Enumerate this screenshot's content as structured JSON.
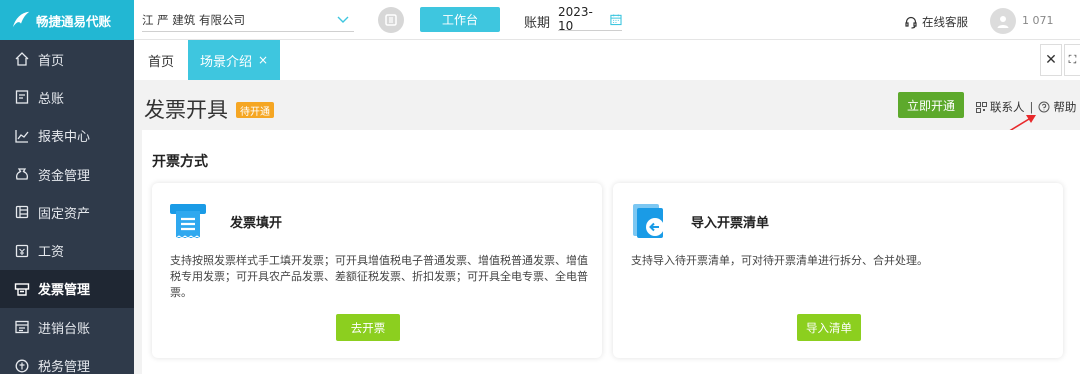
{
  "brand": {
    "name": "畅捷通易代账"
  },
  "sidebar": {
    "items": [
      {
        "label": "首页",
        "icon": "home-icon"
      },
      {
        "label": "总账",
        "icon": "ledger-icon"
      },
      {
        "label": "报表中心",
        "icon": "chart-icon"
      },
      {
        "label": "资金管理",
        "icon": "money-bag-icon"
      },
      {
        "label": "固定资产",
        "icon": "asset-icon"
      },
      {
        "label": "工资",
        "icon": "salary-icon"
      },
      {
        "label": "发票管理",
        "icon": "invoice-icon",
        "active": true
      },
      {
        "label": "进销台账",
        "icon": "inventory-icon"
      },
      {
        "label": "税务管理",
        "icon": "tax-icon"
      }
    ]
  },
  "topbar": {
    "company": "江 严 建筑 有限公司",
    "workbench_label": "工作台",
    "period_label": "账期",
    "period_value": "2023-10",
    "support_label": "在线客服",
    "user_name": "1 071"
  },
  "tabs": {
    "home": "首页",
    "active": "场景介绍",
    "close_glyph": "×",
    "tool_close": "✕",
    "tool_expand": "⛶"
  },
  "header": {
    "title": "发票开具",
    "status": "待开通",
    "open_now": "立即开通",
    "contact": "联系人",
    "separator": "|",
    "help": "帮助"
  },
  "main": {
    "section_title": "开票方式",
    "cards": [
      {
        "title": "发票填开",
        "desc": "支持按照发票样式手工填开发票；可开具增值税电子普通发票、增值税普通发票、增值税专用发票；可开具农产品发票、差额征税发票、折扣发票；可开具全电专票、全电普票。",
        "button": "去开票"
      },
      {
        "title": "导入开票清单",
        "desc": "支持导入待开票清单，可对待开票清单进行拆分、合并处理。",
        "button": "导入清单"
      }
    ]
  },
  "colors": {
    "brand": "#22b7d3",
    "sidebar": "#2f3a4a",
    "accent_green": "#5da92c",
    "button_green": "#8ccf1f",
    "badge_orange": "#f5a623"
  }
}
